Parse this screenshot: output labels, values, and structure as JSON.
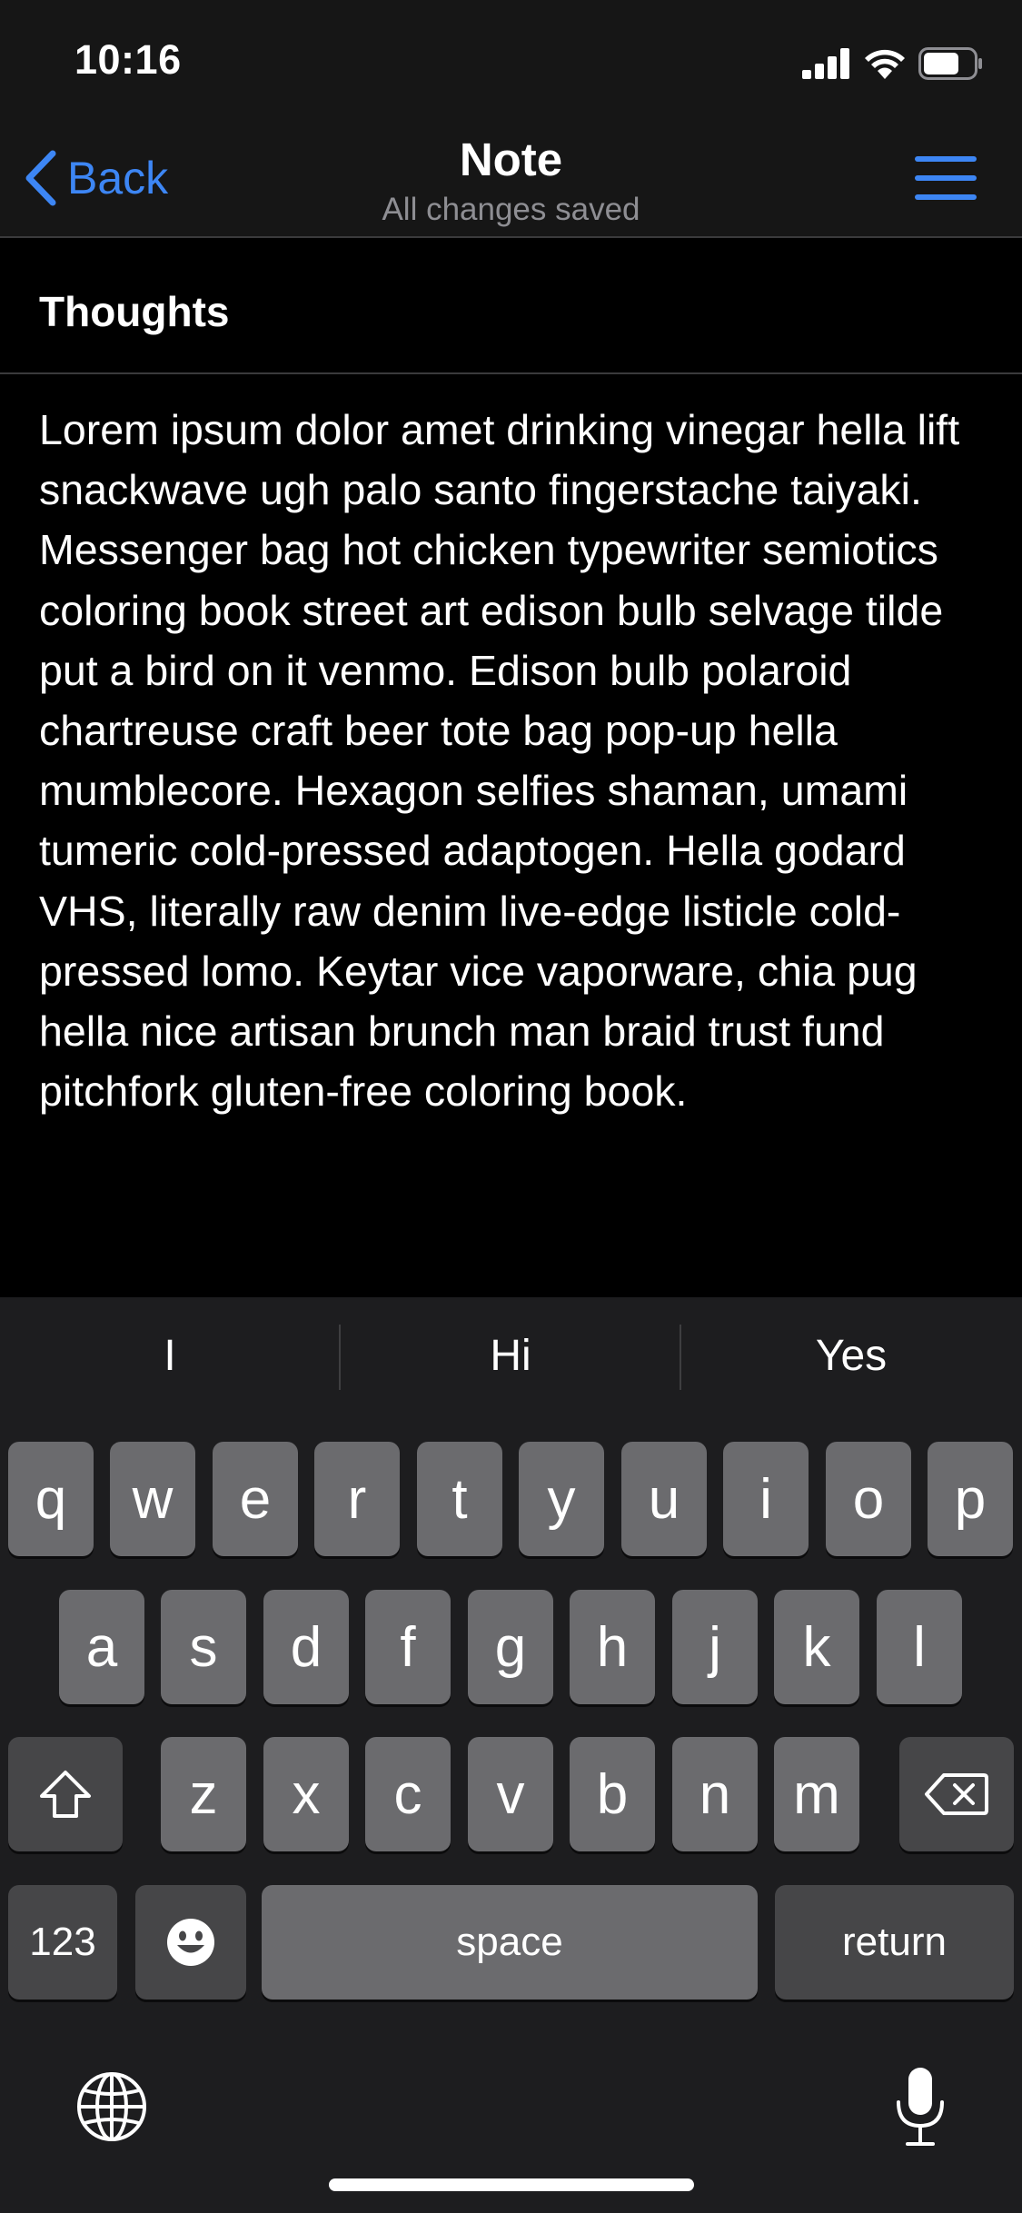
{
  "status": {
    "time": "10:16",
    "signal_icon": "cellular-signal-icon",
    "wifi_icon": "wifi-icon",
    "battery_icon": "battery-icon",
    "battery_level": 0.7
  },
  "nav": {
    "back_label": "Back",
    "title": "Note",
    "subtitle": "All changes saved",
    "menu_icon": "hamburger-menu-icon",
    "accent_color": "#3d86f4"
  },
  "note": {
    "heading": "Thoughts",
    "body": "Lorem ipsum dolor amet drinking vinegar hella lift snackwave ugh palo santo fingerstache taiyaki. Messenger bag hot chicken typewriter semiotics coloring book street art edison bulb selvage tilde put a bird on it venmo. Edison bulb polaroid chartreuse craft beer tote bag pop-up hella mumblecore. Hexagon selfies shaman, umami tumeric cold-pressed adaptogen. Hella godard VHS, literally raw denim live-edge listicle cold-pressed lomo. Keytar vice vaporware, chia pug hella nice artisan brunch man braid trust fund pitchfork gluten-free coloring book."
  },
  "keyboard": {
    "suggestions": [
      "I",
      "Hi",
      "Yes"
    ],
    "row1": [
      "q",
      "w",
      "e",
      "r",
      "t",
      "y",
      "u",
      "i",
      "o",
      "p"
    ],
    "row2": [
      "a",
      "s",
      "d",
      "f",
      "g",
      "h",
      "j",
      "k",
      "l"
    ],
    "row3": [
      "z",
      "x",
      "c",
      "v",
      "b",
      "n",
      "m"
    ],
    "numbers_label": "123",
    "space_label": "space",
    "return_label": "return",
    "shift_icon": "shift-icon",
    "delete_icon": "delete-icon",
    "emoji_icon": "emoji-icon",
    "globe_icon": "globe-icon",
    "mic_icon": "microphone-icon"
  }
}
